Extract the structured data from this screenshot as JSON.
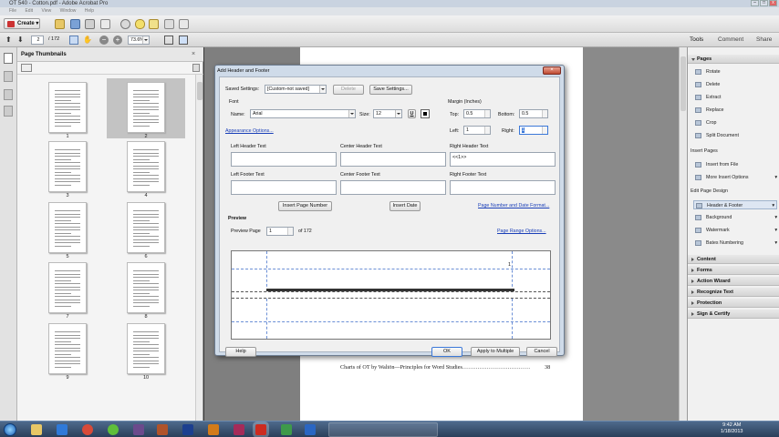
{
  "window": {
    "title": "OT 540 - Cotton.pdf - Adobe Acrobat Pro"
  },
  "menubar": {
    "items": [
      "File",
      "Edit",
      "View",
      "Window",
      "Help"
    ]
  },
  "toolbar": {
    "create_label": "Create",
    "page_current": "2",
    "page_total": "/ 172",
    "zoom": "73.6%",
    "tools_label": "Tools",
    "comment_label": "Comment",
    "share_label": "Share"
  },
  "thumbnails": {
    "title": "Page Thumbnails",
    "pages": [
      "1",
      "2",
      "3",
      "4",
      "5",
      "6",
      "7",
      "8",
      "9",
      "10"
    ]
  },
  "document": {
    "footer_text": "Charts of OT by Waltön—Principles for Word Studies………………………………",
    "page_number": "38"
  },
  "rightpanel": {
    "pages_header": "Pages",
    "pages_items": [
      "Rotate",
      "Delete",
      "Extract",
      "Replace",
      "Crop",
      "Split Document"
    ],
    "insert_pages_header": "Insert Pages",
    "insert_items": [
      "Insert from File",
      "More Insert Options"
    ],
    "edit_design_header": "Edit Page Design",
    "design_items": [
      "Header & Footer",
      "Background",
      "Watermark",
      "Bates Numbering"
    ],
    "collapsed_sections": [
      "Content",
      "Forms",
      "Action Wizard",
      "Recognize Text",
      "Protection",
      "Sign & Certify"
    ]
  },
  "dialog": {
    "title": "Add Header and Footer",
    "saved_settings_label": "Saved Settings:",
    "saved_settings_value": "[Custom-not saved]",
    "delete_label": "Delete",
    "save_settings_label": "Save Settings...",
    "font_label": "Font",
    "name_label": "Name:",
    "font_name": "Arial",
    "size_label": "Size:",
    "font_size": "12",
    "underline_label": "U",
    "margin_label": "Margin (Inches)",
    "top_label": "Top:",
    "top_value": "0.5",
    "bottom_label": "Bottom:",
    "bottom_value": "0.5",
    "left_label": "Left:",
    "left_value": "1",
    "right_label": "Right:",
    "right_value": "1",
    "appearance_options": "Appearance Options...",
    "left_header_label": "Left Header Text",
    "center_header_label": "Center Header Text",
    "right_header_label": "Right Header Text",
    "right_header_value": "<<1>>",
    "left_footer_label": "Left Footer Text",
    "center_footer_label": "Center Footer Text",
    "right_footer_label": "Right Footer Text",
    "insert_page_number": "Insert Page Number",
    "insert_date": "Insert Date",
    "page_number_format": "Page Number and Date Format...",
    "preview_label": "Preview",
    "preview_page_label": "Preview Page",
    "preview_page_value": "1",
    "preview_of": "of 172",
    "page_range_options": "Page Range Options...",
    "preview_header_number": "1",
    "help_label": "Help",
    "ok_label": "OK",
    "apply_multiple_label": "Apply to Multiple",
    "cancel_label": "Cancel"
  },
  "taskbar": {
    "time": "9:42 AM",
    "date": "1/18/2013"
  }
}
